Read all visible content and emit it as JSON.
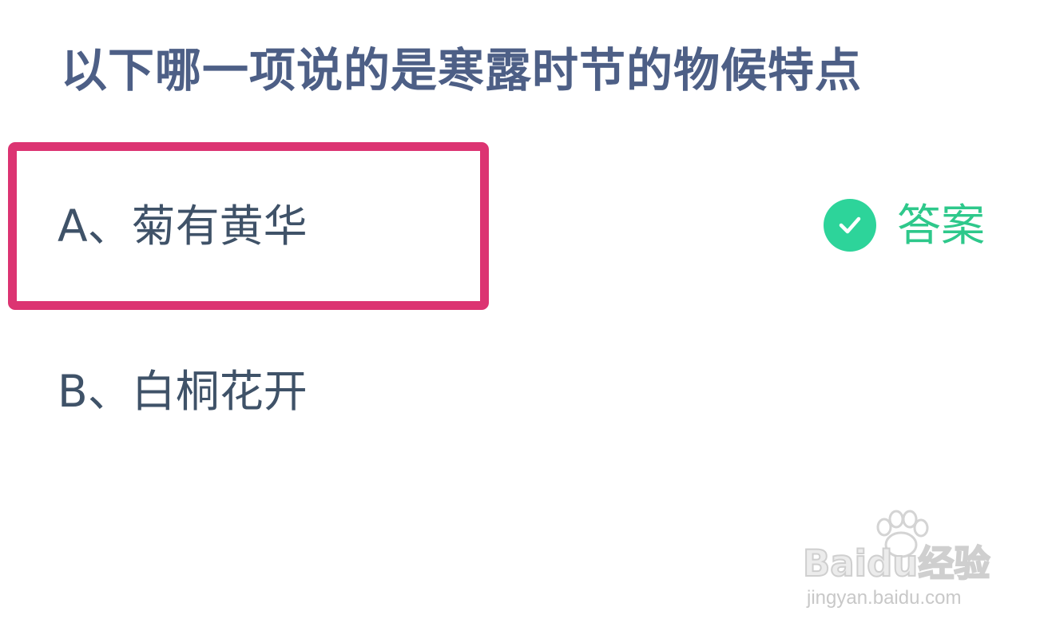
{
  "question": {
    "title": "以下哪一项说的是寒露时节的物候特点"
  },
  "options": [
    {
      "label": "A、菊有黄华",
      "highlighted": true
    },
    {
      "label": "B、白桐花开",
      "highlighted": false
    }
  ],
  "answer_tag": {
    "icon": "check-circle-icon",
    "label": "答案",
    "color": "#2dd49a"
  },
  "highlight": {
    "color": "#dc3472"
  },
  "watermark": {
    "logo": "Baidu经验",
    "url": "jingyan.baidu.com"
  }
}
